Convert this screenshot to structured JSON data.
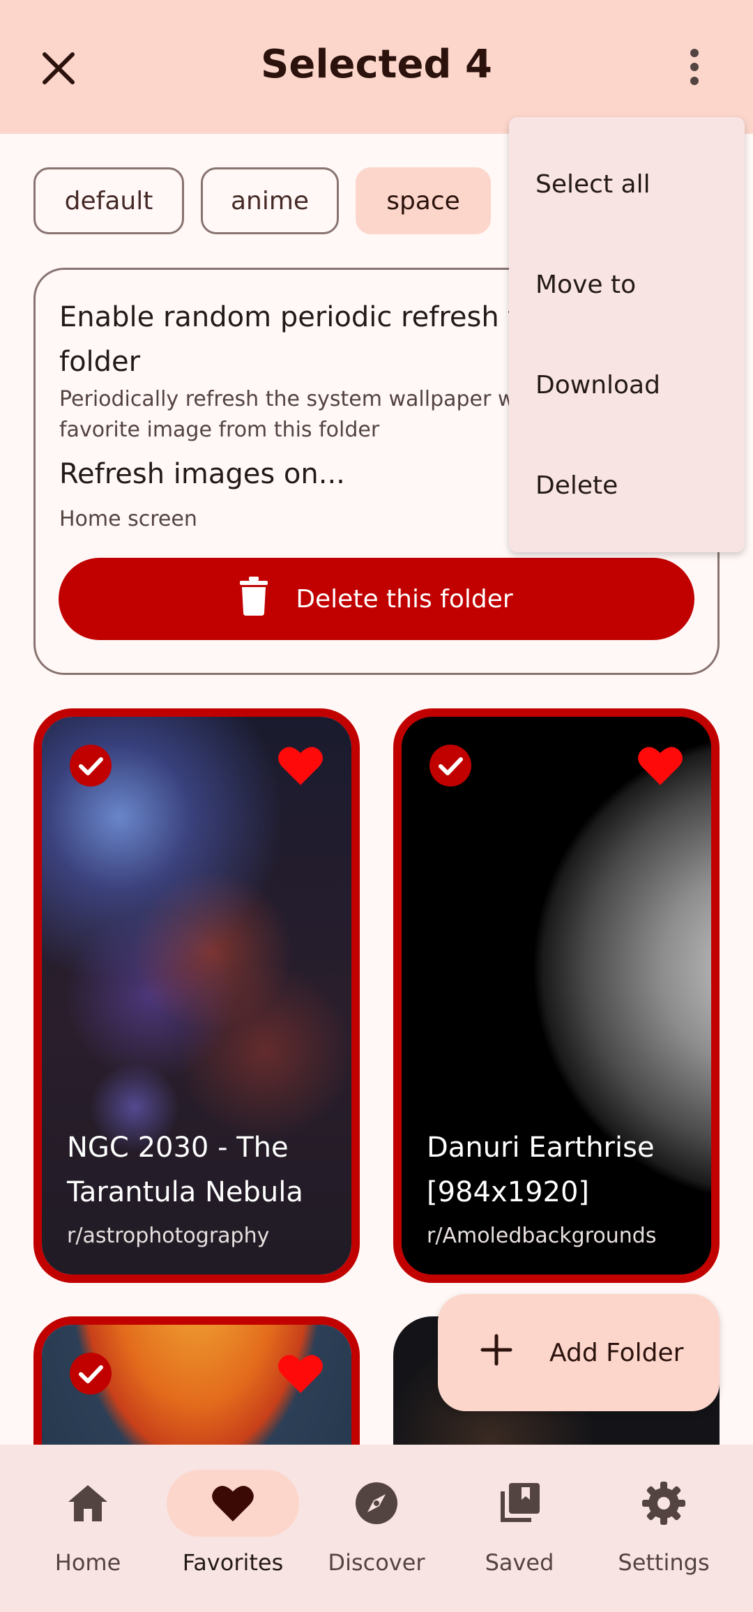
{
  "topbar": {
    "title": "Selected 4",
    "close_icon": "close-icon",
    "more_icon": "more-vert-icon"
  },
  "chips": [
    "default",
    "anime",
    "space"
  ],
  "folder_card": {
    "heading": "Enable random periodic refresh for this folder",
    "description": "Periodically refresh the system wallpaper with a random favorite image from this folder",
    "refresh_title": "Refresh images on...",
    "refresh_value": "Home screen",
    "delete_label": "Delete this folder"
  },
  "images": [
    {
      "title": "NGC 2030 - The Tarantula Nebula",
      "subreddit": "r/astrophotography",
      "selected": true,
      "favorite": true
    },
    {
      "title": "Danuri Earthrise [984x1920]",
      "subreddit": "r/Amoledbackgrounds",
      "selected": true,
      "favorite": true
    }
  ],
  "menu": {
    "items": [
      "Select all",
      "Move to",
      "Download",
      "Delete"
    ]
  },
  "fab": {
    "label": "Add Folder"
  },
  "nav": {
    "items": [
      "Home",
      "Favorites",
      "Discover",
      "Saved",
      "Settings"
    ],
    "active": "Favorites"
  },
  "colors": {
    "accent": "#c00100",
    "surface_tint": "#fcd6cb",
    "menu_bg": "#f8e4e2"
  }
}
